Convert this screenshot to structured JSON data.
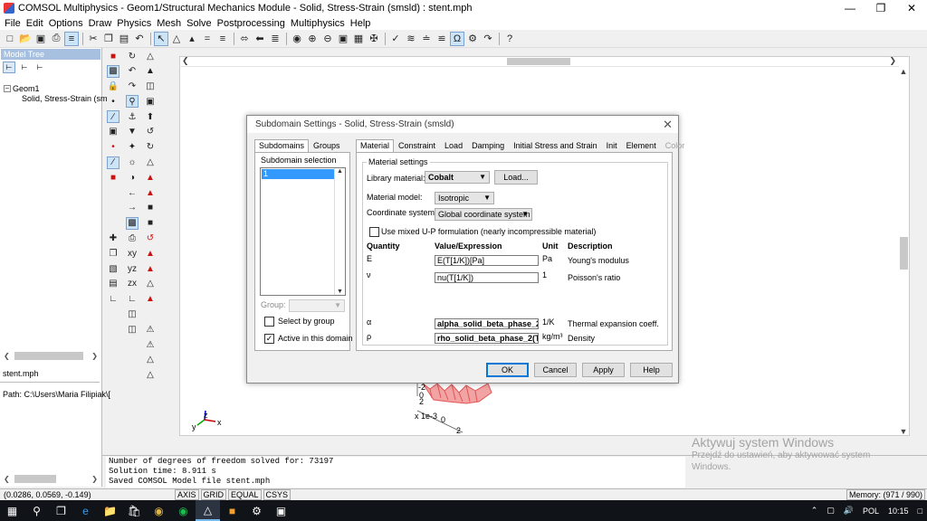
{
  "window": {
    "title": "COMSOL Multiphysics - Geom1/Structural Mechanics Module - Solid, Stress-Strain (smsld) : stent.mph",
    "minimize": "—",
    "restore": "❐",
    "close": "✕"
  },
  "menu": [
    "File",
    "Edit",
    "Options",
    "Draw",
    "Physics",
    "Mesh",
    "Solve",
    "Postprocessing",
    "Multiphysics",
    "Help"
  ],
  "model_tree": {
    "header": "Model Tree",
    "root": "Geom1",
    "child": "Solid, Stress-Strain (sm",
    "file_name": "stent.mph",
    "path": "Path: C:\\Users\\Maria Filipiak\\["
  },
  "canvas": {
    "triad": {
      "y": "y",
      "z": "z",
      "x": "x"
    },
    "fragment": {
      "z_ticks": [
        "-2",
        "0",
        "2"
      ],
      "scale": "x 1e-3",
      "x_ticks": [
        "0",
        "2"
      ]
    }
  },
  "dialog": {
    "title": "Subdomain Settings - Solid, Stress-Strain (smsld)",
    "left_tabs": [
      "Subdomains",
      "Groups"
    ],
    "subdomain_selection_label": "Subdomain selection",
    "selected_item": "1",
    "group_label": "Group:",
    "select_by_group": "Select by group",
    "active_in_domain": "Active in this domain",
    "right_tabs": [
      "Material",
      "Constraint",
      "Load",
      "Damping",
      "Initial Stress and Strain",
      "Init",
      "Element",
      "Color"
    ],
    "material_settings": "Material settings",
    "library_material_label": "Library material:",
    "library_material_value": "Cobalt",
    "load_button": "Load...",
    "material_model_label": "Material model:",
    "material_model_value": "Isotropic",
    "coord_system_label": "Coordinate system:",
    "coord_system_value": "Global coordinate system",
    "mixed_formulation": "Use mixed U-P formulation (nearly incompressible material)",
    "headers": {
      "quantity": "Quantity",
      "value": "Value/Expression",
      "unit": "Unit",
      "description": "Description"
    },
    "rows": [
      {
        "quantity": "E",
        "value": "E(T[1/K])[Pa]",
        "unit": "Pa",
        "description": "Young's modulus"
      },
      {
        "quantity": "ν",
        "value": "nu(T[1/K])",
        "unit": "1",
        "description": "Poisson's ratio"
      },
      {
        "quantity": "α",
        "value": "alpha_solid_beta_phase_2",
        "unit": "1/K",
        "description": "Thermal expansion coeff."
      },
      {
        "quantity": "ρ",
        "value": "rho_solid_beta_phase_2(T",
        "unit": "kg/m³",
        "description": "Density"
      }
    ],
    "buttons": {
      "ok": "OK",
      "cancel": "Cancel",
      "apply": "Apply",
      "help": "Help"
    }
  },
  "console": [
    "Number of degrees of freedom solved for: 73197",
    "Solution time: 8.911 s",
    "Saved COMSOL Model file stent.mph"
  ],
  "status": {
    "coords": "(0.0286, 0.0569, -0.149)",
    "toggles": [
      "AXIS",
      "GRID",
      "EQUAL",
      "CSYS"
    ],
    "memory": "Memory: (971 / 990)"
  },
  "watermark": {
    "title": "Aktywuj system Windows",
    "subtitle": "Przejdź do ustawień, aby aktywować system Windows."
  },
  "taskbar": {
    "time": "10:15",
    "language": "POL"
  }
}
